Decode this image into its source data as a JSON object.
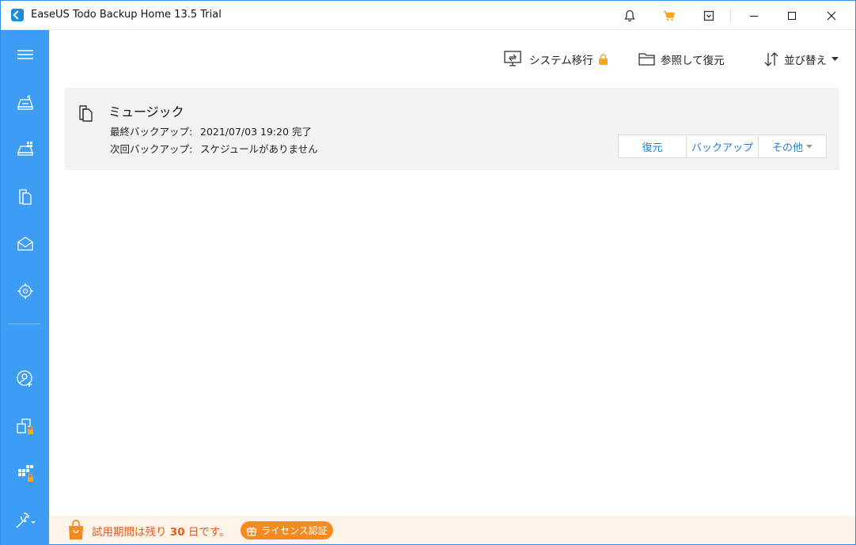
{
  "window": {
    "title": "EaseUS Todo Backup Home 13.5 Trial",
    "accent": "#3d9df5",
    "cart_color": "#f5a623"
  },
  "titlebar_icons": [
    "bell-icon",
    "cart-icon",
    "download-box-icon"
  ],
  "window_controls": [
    "minimize",
    "maximize",
    "close"
  ],
  "sidebar": {
    "items": [
      {
        "name": "menu-icon"
      },
      {
        "name": "disk-backup-icon"
      },
      {
        "name": "system-backup-icon"
      },
      {
        "name": "file-backup-icon"
      },
      {
        "name": "mail-backup-icon"
      },
      {
        "name": "smart-backup-icon"
      },
      {
        "name": "account-add-icon"
      },
      {
        "name": "clone-locked-icon"
      },
      {
        "name": "windows-locked-icon"
      },
      {
        "name": "tools-icon"
      }
    ]
  },
  "toolbar": {
    "system_migrate": "システム移行",
    "browse_restore": "参照して復元",
    "sort": "並び替え"
  },
  "backup_task": {
    "name": "ミュージック",
    "last_backup_label": "最終バックアップ:",
    "last_backup_value": "2021/07/03 19:20 完了",
    "next_backup_label": "次回バックアップ:",
    "next_backup_value": "スケジュールがありません",
    "actions": {
      "restore": "復元",
      "backup": "バックアップ",
      "more": "その他"
    }
  },
  "footer": {
    "trial_prefix": "試用期間は残り",
    "trial_days": "30",
    "trial_suffix": "日です。",
    "license_button": "ライセンス認証",
    "trial_color": "#e35c1b",
    "button_color": "#f58a1f"
  }
}
